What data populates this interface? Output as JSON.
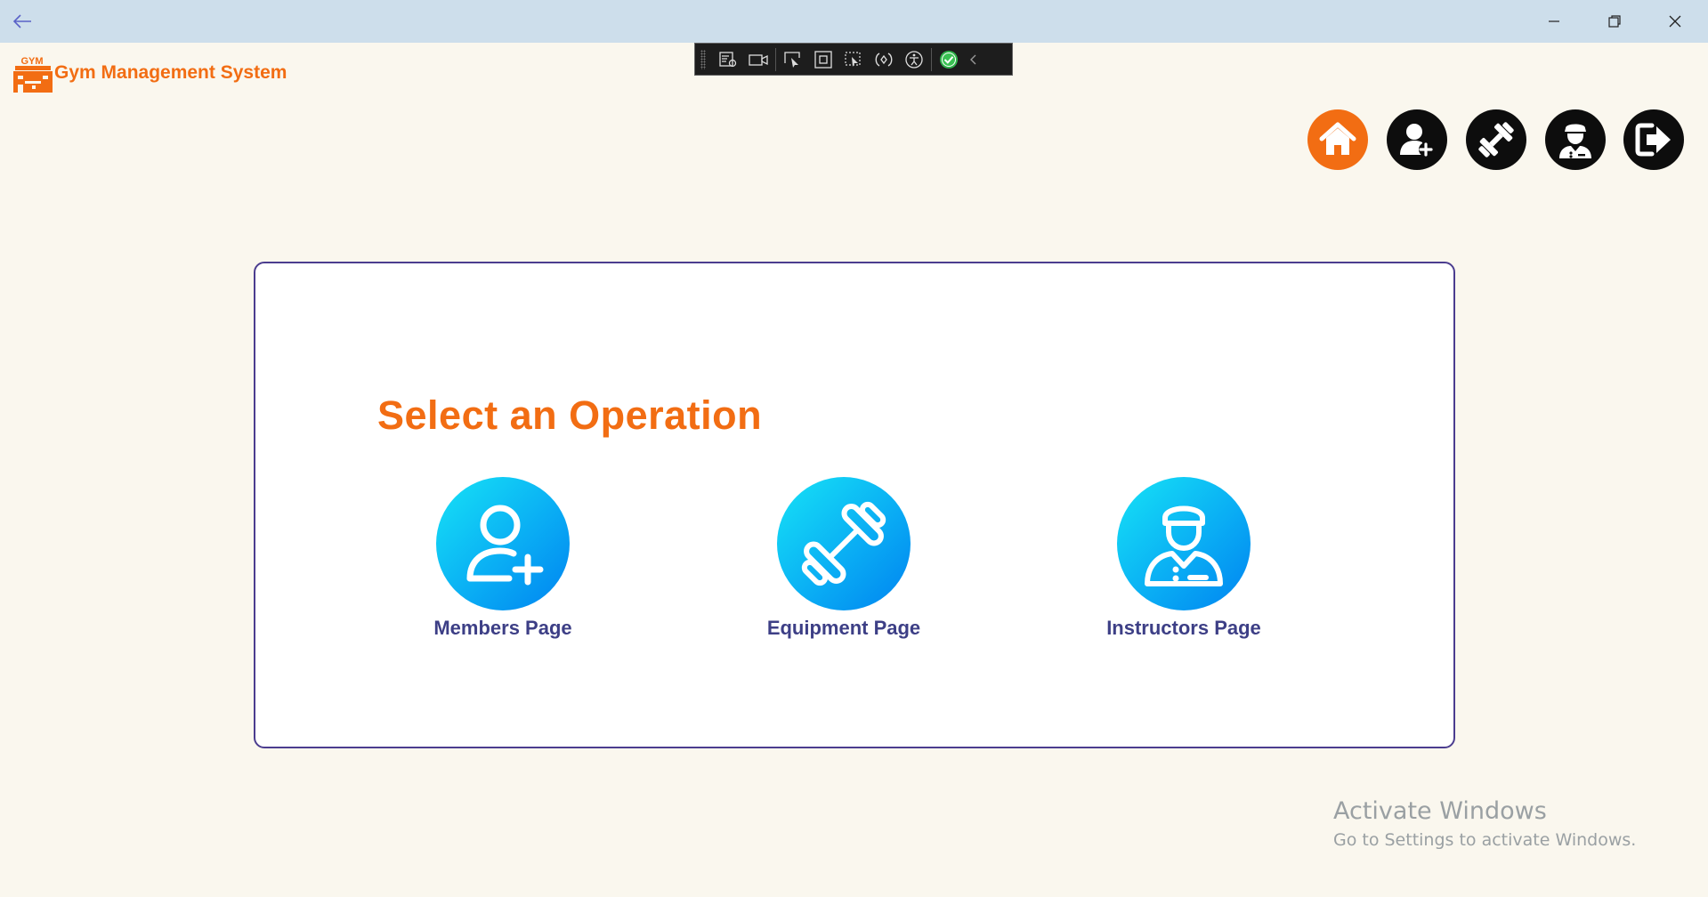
{
  "window": {
    "back_icon": "arrow-left-icon",
    "minimize_icon": "minimize-icon",
    "restore_icon": "restore-icon",
    "close_icon": "close-icon"
  },
  "debug_toolbar": {
    "tools": [
      "live-visual-tree-icon",
      "video-icon",
      "select-element-icon",
      "display-layout-adorners-icon",
      "track-focus-icon",
      "binding-failures-icon",
      "accessibility-icon",
      "hot-reload-check-icon",
      "collapse-chevron-icon"
    ]
  },
  "header": {
    "logo_text": "GYM",
    "title": "Gym Management System"
  },
  "nav": {
    "items": [
      {
        "name": "home",
        "icon": "home-icon",
        "active": true
      },
      {
        "name": "members",
        "icon": "add-user-icon",
        "active": false
      },
      {
        "name": "equipment",
        "icon": "dumbbell-icon",
        "active": false
      },
      {
        "name": "instructors",
        "icon": "instructor-icon",
        "active": false
      },
      {
        "name": "logout",
        "icon": "logout-arrow-icon",
        "active": false
      }
    ]
  },
  "main": {
    "title": "Select an Operation",
    "operations": [
      {
        "label": "Members Page",
        "icon": "add-user-icon"
      },
      {
        "label": "Equipment Page",
        "icon": "dumbbell-icon"
      },
      {
        "label": "Instructors Page",
        "icon": "instructor-icon"
      }
    ]
  },
  "watermark": {
    "title": "Activate Windows",
    "subtitle": "Go to Settings to activate Windows."
  },
  "colors": {
    "accent_orange": "#f26d13",
    "label_purple": "#3d3f86",
    "card_border": "#4b3d8f",
    "icon_gradient_start": "#16e3f6",
    "icon_gradient_end": "#0083f0",
    "nav_dark": "#0d0d0d",
    "background": "#faf7ee"
  }
}
